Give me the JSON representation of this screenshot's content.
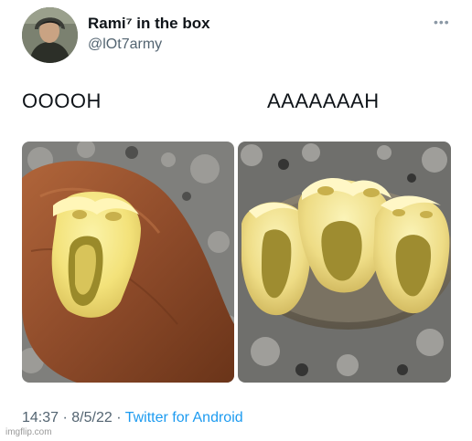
{
  "tweet": {
    "display_name": "Rami⁷ in the box",
    "handle": "@lOt7army",
    "more_icon": "more-dots-icon",
    "captions": {
      "left": "OOOOH",
      "right": "AAAAAAAH"
    },
    "time": "14:37",
    "date": "8/5/22",
    "separator": "·",
    "source": "Twitter for Android"
  },
  "watermark": "imgflip.com",
  "colors": {
    "link": "#1d9bf0",
    "muted": "#536471",
    "text": "#0f1419"
  }
}
